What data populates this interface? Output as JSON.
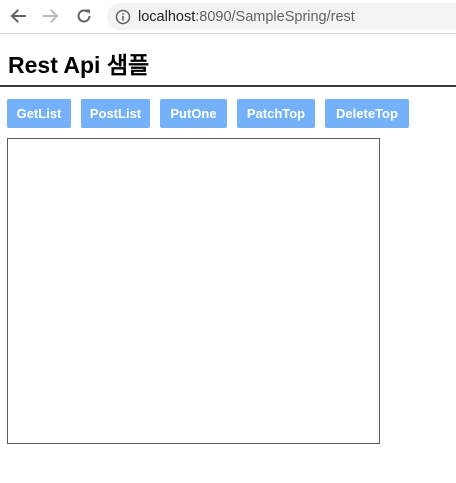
{
  "browser": {
    "url_host": "localhost",
    "url_rest": ":8090/SampleSpring/rest",
    "icons": {
      "back": "arrow-left-icon",
      "forward": "arrow-right-icon",
      "reload": "reload-icon",
      "info": "info-icon"
    }
  },
  "page": {
    "title": "Rest Api 샘플"
  },
  "buttons": [
    {
      "label": "GetList"
    },
    {
      "label": "PostList"
    },
    {
      "label": "PutOne"
    },
    {
      "label": "PatchTop"
    },
    {
      "label": "DeleteTop"
    }
  ],
  "result": {
    "content": ""
  },
  "colors": {
    "button_bg": "#74b1f8",
    "button_text": "#ffffff",
    "title_rule": "#3a3a3a",
    "result_border": "#5c5c5c",
    "omnibox_bg": "#f1f3f4"
  }
}
